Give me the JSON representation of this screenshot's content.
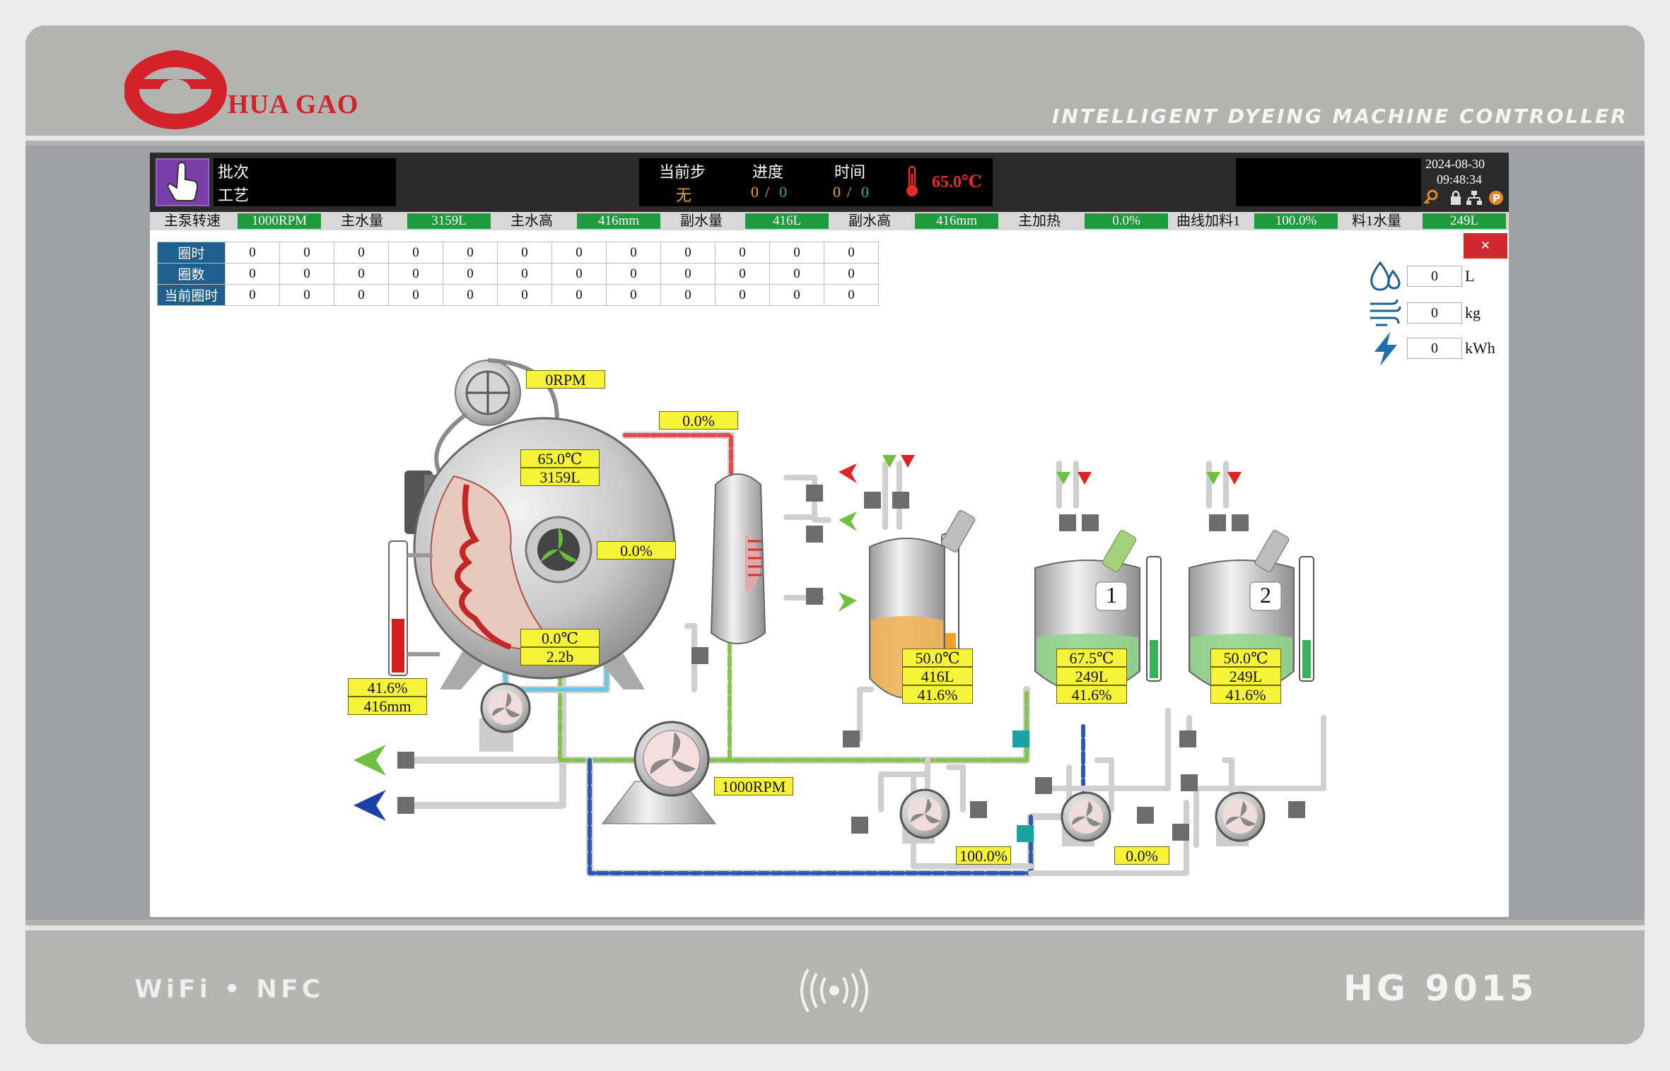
{
  "brand": {
    "name": "HUA GAO",
    "device_title": "INTELLIGENT DYEING MACHINE CONTROLLER",
    "connectivity": "WiFi • NFC",
    "model": "HG 9015"
  },
  "colors": {
    "brand_red": "#d3222a",
    "status_green": "#1f9a3d",
    "purple": "#7a3ea8",
    "label_yellow": "#f7f338",
    "table_blue": "#1f5f8e"
  },
  "header": {
    "batch_label": "批次",
    "recipe_label": "工艺",
    "current_step_label": "当前步",
    "current_step_value": "无",
    "progress_label": "进度",
    "progress_done": "0",
    "progress_total": "0",
    "slash": "/",
    "time_label": "时间",
    "time_done": "0",
    "time_total": "0",
    "temperature": "65.0℃",
    "date": "2024-08-30",
    "time": "09:48:34",
    "icons": [
      "hand-pointer-icon",
      "thermometer-icon",
      "key-icon",
      "lock-icon",
      "network-icon",
      "parking-icon"
    ]
  },
  "status_bar": [
    {
      "label": "主泵转速",
      "value": "1000RPM"
    },
    {
      "label": "主水量",
      "value": "3159L"
    },
    {
      "label": "主水高",
      "value": "416mm"
    },
    {
      "label": "副水量",
      "value": "416L"
    },
    {
      "label": "副水高",
      "value": "416mm"
    },
    {
      "label": "主加热",
      "value": "0.0%"
    },
    {
      "label": "曲线加料1",
      "value": "100.0%"
    },
    {
      "label": "料1水量",
      "value": "249L"
    }
  ],
  "loop_table": {
    "rows": [
      {
        "label": "圈时",
        "values": [
          "0",
          "0",
          "0",
          "0",
          "0",
          "0",
          "0",
          "0",
          "0",
          "0",
          "0",
          "0"
        ]
      },
      {
        "label": "圈数",
        "values": [
          "0",
          "0",
          "0",
          "0",
          "0",
          "0",
          "0",
          "0",
          "0",
          "0",
          "0",
          "0"
        ]
      },
      {
        "label": "当前圈时",
        "values": [
          "0",
          "0",
          "0",
          "0",
          "0",
          "0",
          "0",
          "0",
          "0",
          "0",
          "0",
          "0"
        ]
      }
    ]
  },
  "usage": [
    {
      "icon": "water-drops-icon",
      "value": "0",
      "unit": "L"
    },
    {
      "icon": "steam-icon",
      "value": "0",
      "unit": "kg"
    },
    {
      "icon": "lightning-icon",
      "value": "0",
      "unit": "kWh"
    }
  ],
  "close_label": "×",
  "diagram": {
    "reel_rpm": "0RPM",
    "top_pipe_pct": "0.0%",
    "vessel_temp": "65.0℃",
    "vessel_volume": "3159L",
    "vessel_right_pct": "0.0%",
    "vessel_bottom_temp": "0.0℃",
    "vessel_pressure": "2.2b",
    "level_pct": "41.6%",
    "level_height": "416mm",
    "main_pump_rpm": "1000RPM",
    "aux_tank": {
      "temp": "50.0℃",
      "volume": "416L",
      "pct": "41.6%"
    },
    "tank1": {
      "number": "1",
      "temp": "67.5℃",
      "volume": "249L",
      "pct": "41.6%"
    },
    "tank2": {
      "number": "2",
      "temp": "50.0℃",
      "volume": "249L",
      "pct": "41.6%"
    },
    "dosing_pct_1": "100.0%",
    "dosing_pct_2": "0.0%"
  }
}
